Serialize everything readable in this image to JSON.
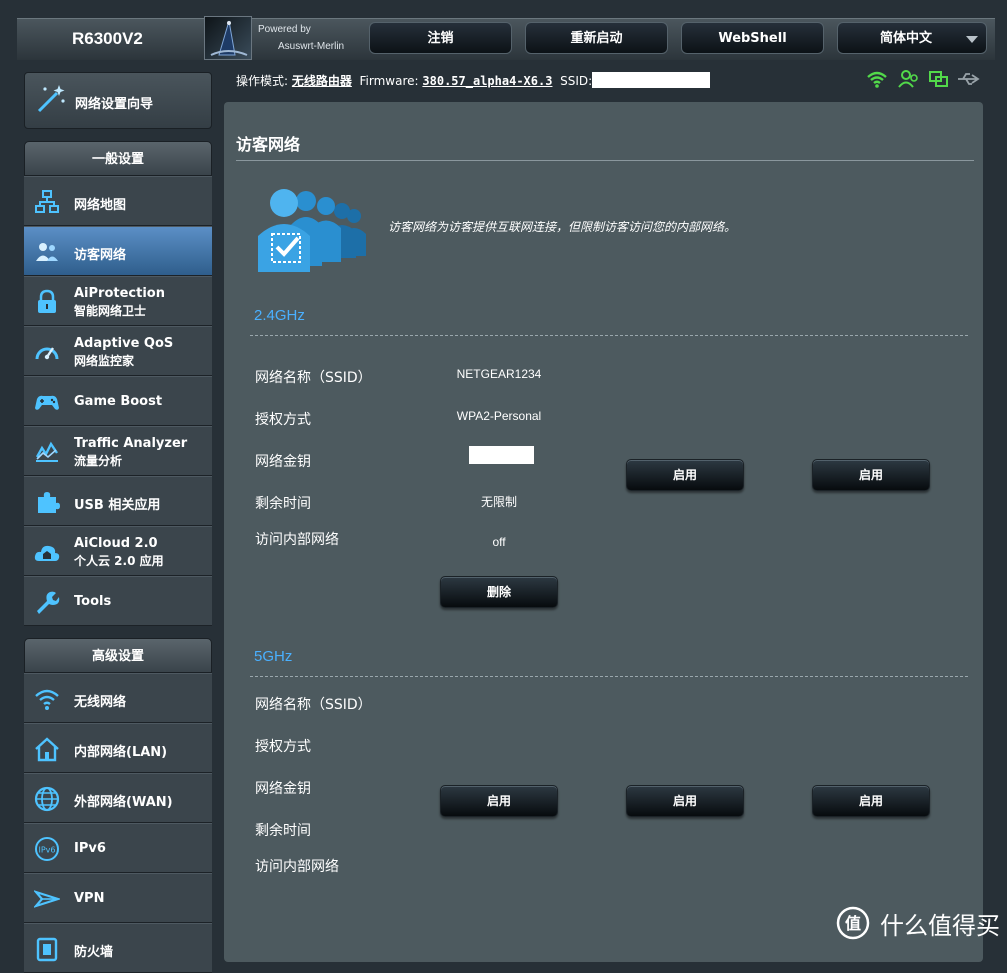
{
  "header": {
    "model": "R6300V2",
    "powered_by": "Powered by",
    "firmware_brand": "Asuswrt-Merlin",
    "buttons": {
      "logout": "注销",
      "reboot": "重新启动",
      "webshell": "WebShell",
      "language": "简体中文"
    }
  },
  "status": {
    "mode_label": "操作模式:",
    "mode_value": "无线路由器",
    "firmware_label": "Firmware:",
    "firmware_value": "380.57_alpha4-X6.3",
    "ssid_label": "SSID:"
  },
  "sidebar": {
    "wizard": "网络设置向导",
    "general_header": "一般设置",
    "general_items": [
      {
        "label": "网络地图"
      },
      {
        "label": "访客网络"
      },
      {
        "label": "AiProtection",
        "sub": "智能网络卫士"
      },
      {
        "label": "Adaptive QoS",
        "sub": "网络监控家"
      },
      {
        "label": "Game Boost"
      },
      {
        "label": "Traffic Analyzer",
        "sub": "流量分析"
      },
      {
        "label": "USB 相关应用"
      },
      {
        "label": "AiCloud 2.0",
        "sub": "个人云 2.0 应用"
      },
      {
        "label": "Tools"
      }
    ],
    "advanced_header": "高级设置",
    "advanced_items": [
      {
        "label": "无线网络"
      },
      {
        "label": "内部网络(LAN)"
      },
      {
        "label": "外部网络(WAN)"
      },
      {
        "label": "IPv6"
      },
      {
        "label": "VPN"
      },
      {
        "label": "防火墙"
      }
    ]
  },
  "main": {
    "title": "访客网络",
    "intro": "访客网络为访客提供互联网连接，但限制访客访问您的内部网络。",
    "labels": {
      "ssid": "网络名称（SSID）",
      "auth": "授权方式",
      "key": "网络金钥",
      "time": "剩余时间",
      "intranet": "访问内部网络"
    },
    "band24": {
      "title": "2.4GHz",
      "ssid": "NETGEAR1234",
      "auth": "WPA2-Personal",
      "time": "无限制",
      "intranet": "off",
      "remove_label": "删除",
      "enable_label": "启用"
    },
    "band5": {
      "title": "5GHz",
      "enable_label": "启用"
    }
  },
  "watermark": {
    "text": "什么值得买",
    "icon_char": "值"
  }
}
